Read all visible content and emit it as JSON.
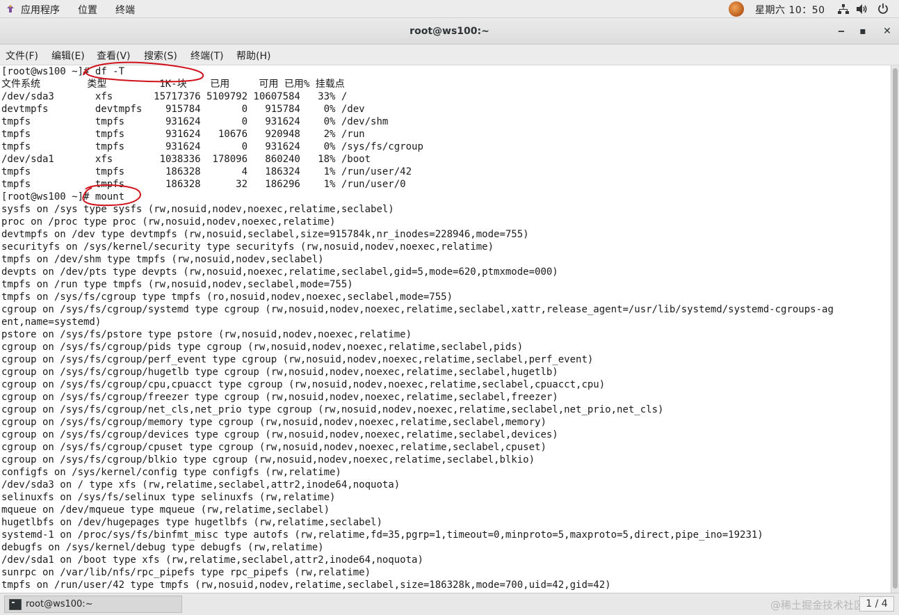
{
  "top_panel": {
    "apps_label": "应用程序",
    "places_label": "位置",
    "terminal_label": "终端",
    "clock": "星期六 10：50",
    "icons": [
      "apps-icon",
      "user-avatar-icon",
      "network-icon",
      "volume-icon",
      "power-icon"
    ]
  },
  "window": {
    "title": "root@ws100:~",
    "minimize": "‒",
    "maximize": "▪",
    "close": "✕"
  },
  "menu": {
    "items": [
      "文件(F)",
      "编辑(E)",
      "查看(V)",
      "搜索(S)",
      "终端(T)",
      "帮助(H)"
    ]
  },
  "terminal": {
    "lines": [
      "[root@ws100 ~]# df -T",
      "文件系统        类型         1K-块    已用     可用 已用% 挂载点",
      "/dev/sda3       xfs       15717376 5109792 10607584   33% /",
      "devtmpfs        devtmpfs    915784       0   915784    0% /dev",
      "tmpfs           tmpfs       931624       0   931624    0% /dev/shm",
      "tmpfs           tmpfs       931624   10676   920948    2% /run",
      "tmpfs           tmpfs       931624       0   931624    0% /sys/fs/cgroup",
      "/dev/sda1       xfs        1038336  178096   860240   18% /boot",
      "tmpfs           tmpfs       186328       4   186324    1% /run/user/42",
      "tmpfs           tmpfs       186328      32   186296    1% /run/user/0",
      "[root@ws100 ~]# mount",
      "sysfs on /sys type sysfs (rw,nosuid,nodev,noexec,relatime,seclabel)",
      "proc on /proc type proc (rw,nosuid,nodev,noexec,relatime)",
      "devtmpfs on /dev type devtmpfs (rw,nosuid,seclabel,size=915784k,nr_inodes=228946,mode=755)",
      "securityfs on /sys/kernel/security type securityfs (rw,nosuid,nodev,noexec,relatime)",
      "tmpfs on /dev/shm type tmpfs (rw,nosuid,nodev,seclabel)",
      "devpts on /dev/pts type devpts (rw,nosuid,noexec,relatime,seclabel,gid=5,mode=620,ptmxmode=000)",
      "tmpfs on /run type tmpfs (rw,nosuid,nodev,seclabel,mode=755)",
      "tmpfs on /sys/fs/cgroup type tmpfs (ro,nosuid,nodev,noexec,seclabel,mode=755)",
      "cgroup on /sys/fs/cgroup/systemd type cgroup (rw,nosuid,nodev,noexec,relatime,seclabel,xattr,release_agent=/usr/lib/systemd/systemd-cgroups-ag",
      "ent,name=systemd)",
      "pstore on /sys/fs/pstore type pstore (rw,nosuid,nodev,noexec,relatime)",
      "cgroup on /sys/fs/cgroup/pids type cgroup (rw,nosuid,nodev,noexec,relatime,seclabel,pids)",
      "cgroup on /sys/fs/cgroup/perf_event type cgroup (rw,nosuid,nodev,noexec,relatime,seclabel,perf_event)",
      "cgroup on /sys/fs/cgroup/hugetlb type cgroup (rw,nosuid,nodev,noexec,relatime,seclabel,hugetlb)",
      "cgroup on /sys/fs/cgroup/cpu,cpuacct type cgroup (rw,nosuid,nodev,noexec,relatime,seclabel,cpuacct,cpu)",
      "cgroup on /sys/fs/cgroup/freezer type cgroup (rw,nosuid,nodev,noexec,relatime,seclabel,freezer)",
      "cgroup on /sys/fs/cgroup/net_cls,net_prio type cgroup (rw,nosuid,nodev,noexec,relatime,seclabel,net_prio,net_cls)",
      "cgroup on /sys/fs/cgroup/memory type cgroup (rw,nosuid,nodev,noexec,relatime,seclabel,memory)",
      "cgroup on /sys/fs/cgroup/devices type cgroup (rw,nosuid,nodev,noexec,relatime,seclabel,devices)",
      "cgroup on /sys/fs/cgroup/cpuset type cgroup (rw,nosuid,nodev,noexec,relatime,seclabel,cpuset)",
      "cgroup on /sys/fs/cgroup/blkio type cgroup (rw,nosuid,nodev,noexec,relatime,seclabel,blkio)",
      "configfs on /sys/kernel/config type configfs (rw,relatime)",
      "/dev/sda3 on / type xfs (rw,relatime,seclabel,attr2,inode64,noquota)",
      "selinuxfs on /sys/fs/selinux type selinuxfs (rw,relatime)",
      "mqueue on /dev/mqueue type mqueue (rw,relatime,seclabel)",
      "hugetlbfs on /dev/hugepages type hugetlbfs (rw,relatime,seclabel)",
      "systemd-1 on /proc/sys/fs/binfmt_misc type autofs (rw,relatime,fd=35,pgrp=1,timeout=0,minproto=5,maxproto=5,direct,pipe_ino=19231)",
      "debugfs on /sys/kernel/debug type debugfs (rw,relatime)",
      "/dev/sda1 on /boot type xfs (rw,relatime,seclabel,attr2,inode64,noquota)",
      "sunrpc on /var/lib/nfs/rpc_pipefs type rpc_pipefs (rw,relatime)",
      "tmpfs on /run/user/42 type tmpfs (rw,nosuid,nodev,relatime,seclabel,size=186328k,mode=700,uid=42,gid=42)"
    ],
    "annotation_color": "#d0101a"
  },
  "taskbar": {
    "task_label": "root@ws100:~",
    "watermark": "@稀土掘金技术社区",
    "pager": "1 / 4"
  }
}
